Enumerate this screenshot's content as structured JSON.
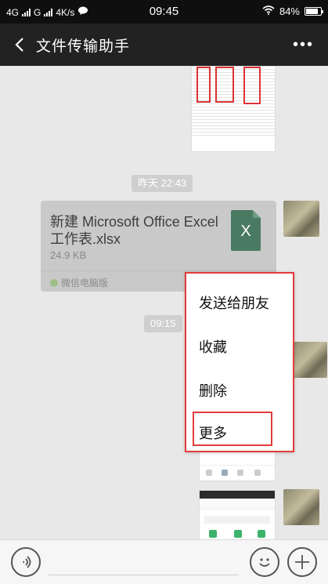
{
  "status_bar": {
    "net1": "4G",
    "net2": "G",
    "speed": "4K/s",
    "time": "09:45",
    "battery": "84%",
    "battery_level": 0.84
  },
  "header": {
    "title": "文件传输助手",
    "more": "•••"
  },
  "chat": {
    "time_yesterday": "昨天 22:43",
    "time_today": "09:15",
    "file": {
      "name": "新建 Microsoft Office Excel 工作表.xlsx",
      "size": "24.9 KB",
      "icon_letter": "X",
      "source": "微信电脑版"
    }
  },
  "context_menu": {
    "items": [
      "发送给朋友",
      "收藏",
      "删除",
      "更多"
    ],
    "highlight_color": "#e23b3b"
  },
  "icons": [
    "back-arrow-icon",
    "more-dots-icon",
    "voice-icon",
    "emoji-icon",
    "plus-icon",
    "wechat-pc-icon",
    "excel-file-icon",
    "chat-icon",
    "wifi-icon"
  ]
}
